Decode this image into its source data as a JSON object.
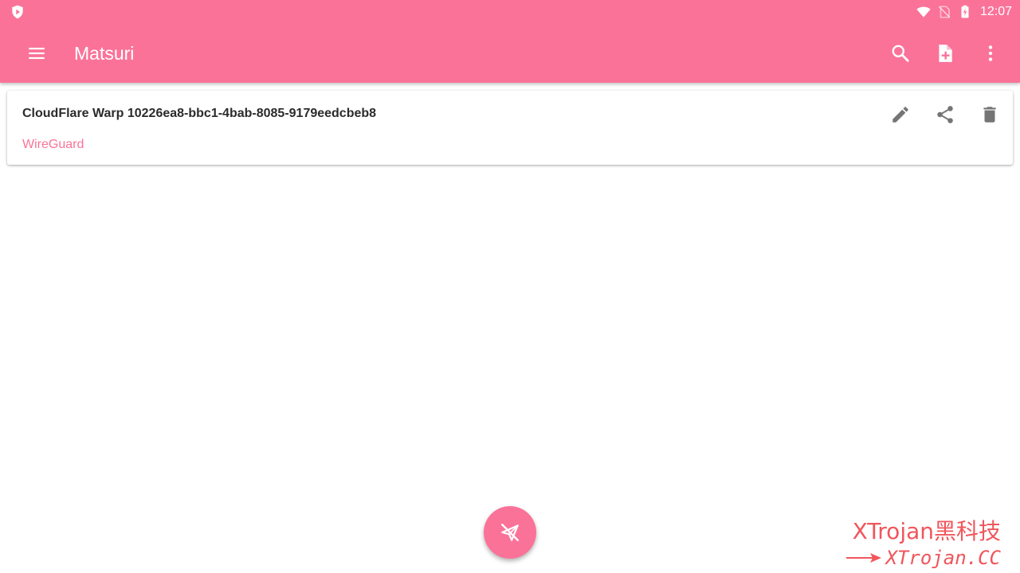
{
  "status_bar": {
    "time": "12:07",
    "icons": [
      "shield-icon",
      "wifi-icon",
      "no-sim-icon",
      "battery-charging-icon"
    ]
  },
  "app_bar": {
    "menu_icon": "menu-icon",
    "title": "Matsuri",
    "actions": [
      "search-icon",
      "add-file-icon",
      "more-vert-icon"
    ]
  },
  "profiles": [
    {
      "name": "CloudFlare Warp 10226ea8-bbc1-4bab-8085-9179eedcbeb8",
      "type": "WireGuard",
      "actions": [
        "edit-icon",
        "share-icon",
        "delete-icon"
      ]
    }
  ],
  "fab": {
    "icon": "paper-plane-off-icon"
  },
  "watermark": {
    "line1": "XTrojan黑科技",
    "line2": "XTrojan.CC"
  },
  "colors": {
    "primary": "#fb7299",
    "icon_gray": "#757575",
    "title_text": "#2b2b2b",
    "watermark": "#f0565c"
  }
}
